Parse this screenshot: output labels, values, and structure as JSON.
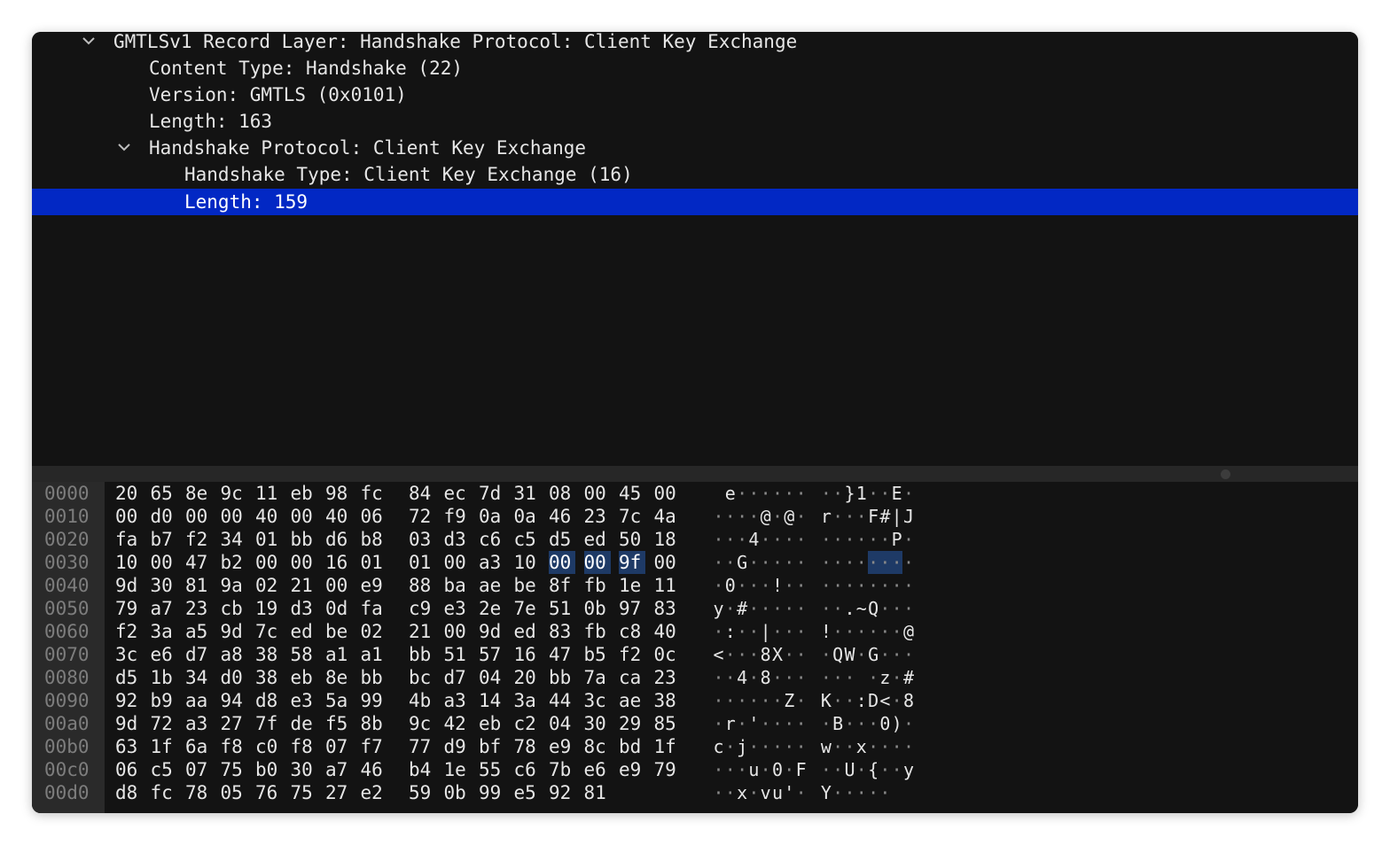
{
  "tree": [
    {
      "text": "GMTLSv1 Record Layer: Handshake Protocol: Client Key Exchange",
      "level": 0,
      "expanded": true,
      "selected": false
    },
    {
      "text": "Content Type: Handshake (22)",
      "level": 1,
      "selected": false
    },
    {
      "text": "Version: GMTLS (0x0101)",
      "level": 1,
      "selected": false
    },
    {
      "text": "Length: 163",
      "level": 1,
      "selected": false
    },
    {
      "text": "Handshake Protocol: Client Key Exchange",
      "level": 1,
      "expanded": true,
      "selected": false
    },
    {
      "text": "Handshake Type: Client Key Exchange (16)",
      "level": 2,
      "selected": false
    },
    {
      "text": "Length: 159",
      "level": 2,
      "selected": true
    }
  ],
  "hex_rows": [
    {
      "offset": "0000",
      "bytes": [
        "20",
        "65",
        "8e",
        "9c",
        "11",
        "eb",
        "98",
        "fc",
        "84",
        "ec",
        "7d",
        "31",
        "08",
        "00",
        "45",
        "00"
      ],
      "ascii": [
        " ",
        "e",
        "·",
        "·",
        "·",
        "·",
        "·",
        "·",
        "·",
        "·",
        "}",
        "1",
        "·",
        "·",
        "E",
        "·"
      ]
    },
    {
      "offset": "0010",
      "bytes": [
        "00",
        "d0",
        "00",
        "00",
        "40",
        "00",
        "40",
        "06",
        "72",
        "f9",
        "0a",
        "0a",
        "46",
        "23",
        "7c",
        "4a"
      ],
      "ascii": [
        "·",
        "·",
        "·",
        "·",
        "@",
        "·",
        "@",
        "·",
        "r",
        "·",
        "·",
        "·",
        "F",
        "#",
        "|",
        "J"
      ]
    },
    {
      "offset": "0020",
      "bytes": [
        "fa",
        "b7",
        "f2",
        "34",
        "01",
        "bb",
        "d6",
        "b8",
        "03",
        "d3",
        "c6",
        "c5",
        "d5",
        "ed",
        "50",
        "18"
      ],
      "ascii": [
        "·",
        "·",
        "·",
        "4",
        "·",
        "·",
        "·",
        "·",
        "·",
        "·",
        "·",
        "·",
        "·",
        "·",
        "P",
        "·"
      ]
    },
    {
      "offset": "0030",
      "bytes": [
        "10",
        "00",
        "47",
        "b2",
        "00",
        "00",
        "16",
        "01",
        "01",
        "00",
        "a3",
        "10",
        "00",
        "00",
        "9f",
        "00"
      ],
      "ascii": [
        "·",
        "·",
        "G",
        "·",
        "·",
        "·",
        "·",
        "·",
        "·",
        "·",
        "·",
        "·",
        "·",
        "·",
        "·",
        "·"
      ]
    },
    {
      "offset": "0040",
      "bytes": [
        "9d",
        "30",
        "81",
        "9a",
        "02",
        "21",
        "00",
        "e9",
        "88",
        "ba",
        "ae",
        "be",
        "8f",
        "fb",
        "1e",
        "11"
      ],
      "ascii": [
        "·",
        "0",
        "·",
        "·",
        "·",
        "!",
        "·",
        "·",
        "·",
        "·",
        "·",
        "·",
        "·",
        "·",
        "·",
        "·"
      ]
    },
    {
      "offset": "0050",
      "bytes": [
        "79",
        "a7",
        "23",
        "cb",
        "19",
        "d3",
        "0d",
        "fa",
        "c9",
        "e3",
        "2e",
        "7e",
        "51",
        "0b",
        "97",
        "83"
      ],
      "ascii": [
        "y",
        "·",
        "#",
        "·",
        "·",
        "·",
        "·",
        "·",
        "·",
        "·",
        ".",
        "~",
        "Q",
        "·",
        "·",
        "·"
      ]
    },
    {
      "offset": "0060",
      "bytes": [
        "f2",
        "3a",
        "a5",
        "9d",
        "7c",
        "ed",
        "be",
        "02",
        "21",
        "00",
        "9d",
        "ed",
        "83",
        "fb",
        "c8",
        "40"
      ],
      "ascii": [
        "·",
        ":",
        "·",
        "·",
        "|",
        "·",
        "·",
        "·",
        "!",
        "·",
        "·",
        "·",
        "·",
        "·",
        "·",
        "@"
      ]
    },
    {
      "offset": "0070",
      "bytes": [
        "3c",
        "e6",
        "d7",
        "a8",
        "38",
        "58",
        "a1",
        "a1",
        "bb",
        "51",
        "57",
        "16",
        "47",
        "b5",
        "f2",
        "0c"
      ],
      "ascii": [
        "<",
        "·",
        "·",
        "·",
        "8",
        "X",
        "·",
        "·",
        "·",
        "Q",
        "W",
        "·",
        "G",
        "·",
        "·",
        "·"
      ]
    },
    {
      "offset": "0080",
      "bytes": [
        "d5",
        "1b",
        "34",
        "d0",
        "38",
        "eb",
        "8e",
        "bb",
        "bc",
        "d7",
        "04",
        "20",
        "bb",
        "7a",
        "ca",
        "23"
      ],
      "ascii": [
        "·",
        "·",
        "4",
        "·",
        "8",
        "·",
        "·",
        "·",
        "·",
        "·",
        "·",
        " ",
        "·",
        "z",
        "·",
        "#"
      ]
    },
    {
      "offset": "0090",
      "bytes": [
        "92",
        "b9",
        "aa",
        "94",
        "d8",
        "e3",
        "5a",
        "99",
        "4b",
        "a3",
        "14",
        "3a",
        "44",
        "3c",
        "ae",
        "38"
      ],
      "ascii": [
        "·",
        "·",
        "·",
        "·",
        "·",
        "·",
        "Z",
        "·",
        "K",
        "·",
        "·",
        ":",
        "D",
        "<",
        "·",
        "8"
      ]
    },
    {
      "offset": "00a0",
      "bytes": [
        "9d",
        "72",
        "a3",
        "27",
        "7f",
        "de",
        "f5",
        "8b",
        "9c",
        "42",
        "eb",
        "c2",
        "04",
        "30",
        "29",
        "85"
      ],
      "ascii": [
        "·",
        "r",
        "·",
        "'",
        "·",
        "·",
        "·",
        "·",
        "·",
        "B",
        "·",
        "·",
        "·",
        "0",
        ")",
        "·"
      ]
    },
    {
      "offset": "00b0",
      "bytes": [
        "63",
        "1f",
        "6a",
        "f8",
        "c0",
        "f8",
        "07",
        "f7",
        "77",
        "d9",
        "bf",
        "78",
        "e9",
        "8c",
        "bd",
        "1f"
      ],
      "ascii": [
        "c",
        "·",
        "j",
        "·",
        "·",
        "·",
        "·",
        "·",
        "w",
        "·",
        "·",
        "x",
        "·",
        "·",
        "·",
        "·"
      ]
    },
    {
      "offset": "00c0",
      "bytes": [
        "06",
        "c5",
        "07",
        "75",
        "b0",
        "30",
        "a7",
        "46",
        "b4",
        "1e",
        "55",
        "c6",
        "7b",
        "e6",
        "e9",
        "79"
      ],
      "ascii": [
        "·",
        "·",
        "·",
        "u",
        "·",
        "0",
        "·",
        "F",
        "·",
        "·",
        "U",
        "·",
        "{",
        "·",
        "·",
        "y"
      ]
    },
    {
      "offset": "00d0",
      "bytes": [
        "d8",
        "fc",
        "78",
        "05",
        "76",
        "75",
        "27",
        "e2",
        "59",
        "0b",
        "99",
        "e5",
        "92",
        "81"
      ],
      "ascii": [
        "·",
        "·",
        "x",
        "·",
        "v",
        "u",
        "'",
        "·",
        "Y",
        "·",
        "·",
        "·",
        "·",
        "·"
      ]
    }
  ],
  "highlight": {
    "row": 3,
    "start": 12,
    "end": 14
  },
  "colors": {
    "selection": "#0228c4",
    "hex_highlight": "#1e3a66",
    "pane_bg": "#131313",
    "offset_gutter": "#2a2a2a"
  }
}
